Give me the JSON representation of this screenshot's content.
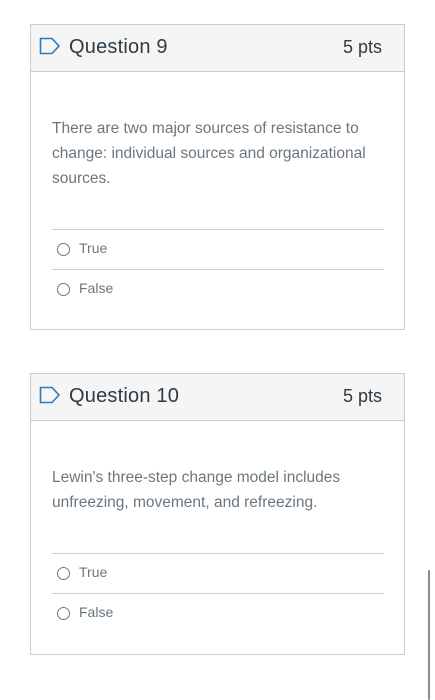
{
  "questions": [
    {
      "title": "Question 9",
      "points": "5 pts",
      "text": "There are two major sources of resistance to change: individual sources and organizational sources.",
      "answers": [
        "True",
        "False"
      ]
    },
    {
      "title": "Question 10",
      "points": "5 pts",
      "text": "Lewin's three-step change model includes unfreezing, movement, and refreezing.",
      "answers": [
        "True",
        "False"
      ]
    }
  ],
  "icons": {
    "flag": "flag-bookmark-icon",
    "radio": "radio-unchecked-icon"
  },
  "colors": {
    "accent": "#2b7abc",
    "border": "#c7cdd1",
    "header_bg": "#f5f5f5",
    "text": "#2d3b45",
    "muted_text": "#6b7780"
  }
}
